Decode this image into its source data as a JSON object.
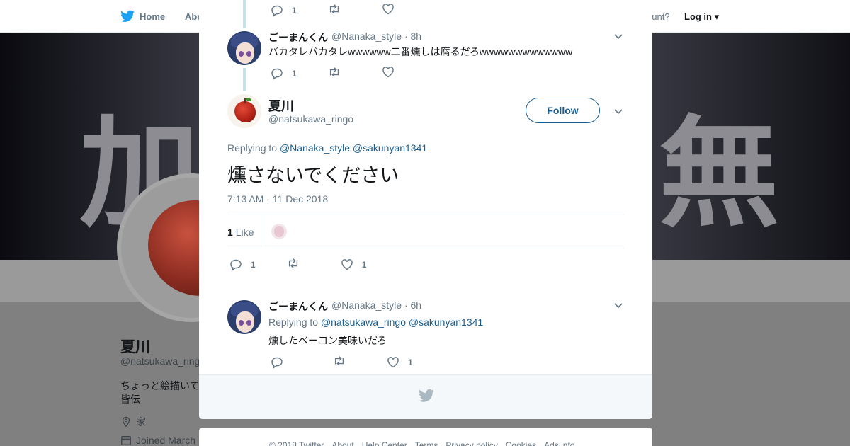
{
  "topbar": {
    "home_label": "Home",
    "about_label": "Abo",
    "account_text": "ccount?",
    "login_label": "Log in"
  },
  "banner": {
    "glyph_left": "加",
    "glyph_right": "無"
  },
  "profile": {
    "name": "夏川",
    "handle": "@natsukawa_ringo",
    "bio_line1": "ちょっと絵描いて",
    "bio_line2": "皆伝",
    "location": "家",
    "joined": "Joined March"
  },
  "thread": {
    "top_actions": {
      "reply_count": "1",
      "retweet_count": "",
      "like_count": ""
    },
    "parent": {
      "name": "ごーまんくん",
      "handle": "@Nanaka_style",
      "time": "· 8h",
      "text": "バカタレバカタレwwwwww二番燻しは腐るだろwwwwwwwwwwwww",
      "reply_count": "1",
      "retweet_count": "",
      "like_count": ""
    },
    "main": {
      "name": "夏川",
      "handle": "@natsukawa_ringo",
      "follow_label": "Follow",
      "replying_prefix": "Replying to",
      "replying_to_1": "@Nanaka_style",
      "replying_to_2": "@sakunyan1341",
      "text": "燻さないでください",
      "timestamp": "7:13 AM - 11 Dec 2018",
      "likes_number": "1",
      "likes_word": "Like",
      "reply_count": "1",
      "retweet_count": "",
      "like_count": "1"
    },
    "reply": {
      "name": "ごーまんくん",
      "handle": "@Nanaka_style",
      "time": "· 6h",
      "replying_prefix": "Replying to",
      "replying_to_1": "@natsukawa_ringo",
      "replying_to_2": "@sakunyan1341",
      "text": "燻したベーコン美味いだろ",
      "reply_count": "",
      "retweet_count": "",
      "like_count": "1"
    }
  },
  "footer": {
    "links": [
      "© 2018 Twitter",
      "About",
      "Help Center",
      "Terms",
      "Privacy policy",
      "Cookies",
      "Ads info"
    ]
  },
  "colors": {
    "link": "#1b5e8f",
    "muted": "#657786",
    "thread_line": "#c4e2ec",
    "twitter_blue": "#1da1f2"
  }
}
